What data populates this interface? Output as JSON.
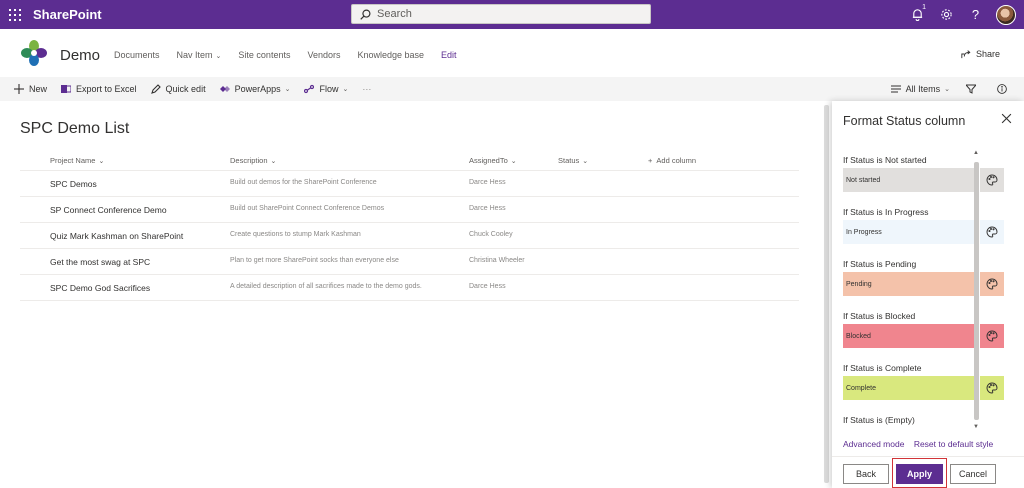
{
  "suite": {
    "app_name": "SharePoint",
    "search_placeholder": "Search",
    "notification_count": "1",
    "help_glyph": "?"
  },
  "site": {
    "name": "Demo",
    "nav": [
      {
        "label": "Documents"
      },
      {
        "label": "Nav Item"
      },
      {
        "label": "Site contents"
      },
      {
        "label": "Vendors"
      },
      {
        "label": "Knowledge base"
      },
      {
        "label": "Edit"
      }
    ],
    "share_label": "Share"
  },
  "commandbar": {
    "new": "New",
    "export": "Export to Excel",
    "quick_edit": "Quick edit",
    "powerapps": "PowerApps",
    "flow": "Flow",
    "more": "···",
    "view": "All Items"
  },
  "list": {
    "title": "SPC Demo List",
    "columns": {
      "project": "Project Name",
      "description": "Description",
      "assigned": "AssignedTo",
      "status": "Status",
      "add": "Add column"
    },
    "rows": [
      {
        "name": "SPC Demos",
        "description": "Build out demos for the SharePoint Conference",
        "assigned": "Darce Hess"
      },
      {
        "name": "SP Connect Conference Demo",
        "description": "Build out SharePoint Connect Conference Demos",
        "assigned": "Darce Hess"
      },
      {
        "name": "Quiz Mark Kashman on SharePoint",
        "description": "Create questions to stump Mark Kashman",
        "assigned": "Chuck Cooley"
      },
      {
        "name": "Get the most swag at SPC",
        "description": "Plan to get more SharePoint socks than everyone else",
        "assigned": "Christina Wheeler"
      },
      {
        "name": "SPC Demo God Sacrifices",
        "description": "A detailed description of all sacrifices made to the demo gods.",
        "assigned": "Darce Hess"
      }
    ]
  },
  "panel": {
    "title": "Format Status column",
    "rules": [
      {
        "label": "If Status is Not started",
        "value": "Not started",
        "color": "#e1dfdd",
        "btn_color": "#e1dfdd"
      },
      {
        "label": "If Status is In Progress",
        "value": "In Progress",
        "color": "#eff6fc",
        "btn_color": "#eff6fc"
      },
      {
        "label": "If Status is Pending",
        "value": "Pending",
        "color": "#f4c2aa",
        "btn_color": "#f4c2aa"
      },
      {
        "label": "If Status is Blocked",
        "value": "Blocked",
        "color": "#f0858e",
        "btn_color": "#f0858e"
      },
      {
        "label": "If Status is Complete",
        "value": "Complete",
        "color": "#d9e87e",
        "btn_color": "#d9e87e"
      },
      {
        "label": "If Status is (Empty)"
      }
    ],
    "advanced_mode": "Advanced mode",
    "reset": "Reset to default style",
    "back": "Back",
    "apply": "Apply",
    "cancel": "Cancel"
  },
  "colors": {
    "suite_purple": "#5c2d91",
    "highlight_red": "#d13438"
  }
}
